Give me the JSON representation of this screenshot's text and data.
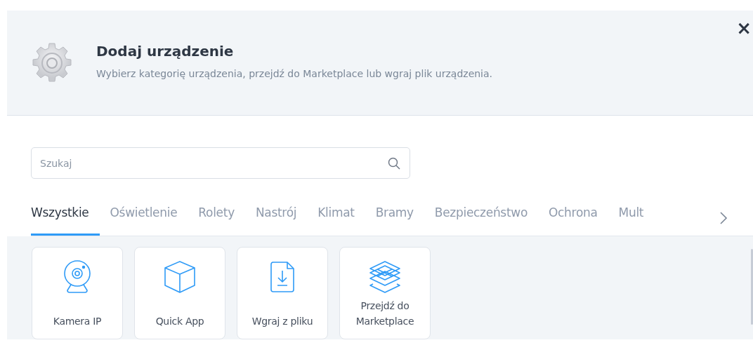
{
  "dialog": {
    "title": "Dodaj urządzenie",
    "subtitle": "Wybierz kategorię urządzenia, przejdź do Marketplace lub wgraj plik urządzenia.",
    "close": "×"
  },
  "search": {
    "placeholder": "Szukaj"
  },
  "tabs": [
    {
      "label": "Wszystkie",
      "selected": true
    },
    {
      "label": "Oświetlenie",
      "selected": false
    },
    {
      "label": "Rolety",
      "selected": false
    },
    {
      "label": "Nastrój",
      "selected": false
    },
    {
      "label": "Klimat",
      "selected": false
    },
    {
      "label": "Bramy",
      "selected": false
    },
    {
      "label": "Bezpieczeństwo",
      "selected": false
    },
    {
      "label": "Ochrona",
      "selected": false
    },
    {
      "label": "Mult",
      "selected": false
    }
  ],
  "tiles": [
    {
      "kind": "camera",
      "label": "Kamera IP"
    },
    {
      "kind": "cube",
      "label": "Quick App"
    },
    {
      "kind": "file",
      "label": "Wgraj z pliku"
    },
    {
      "kind": "layers",
      "label": "Przejdź do Marketplace"
    }
  ]
}
